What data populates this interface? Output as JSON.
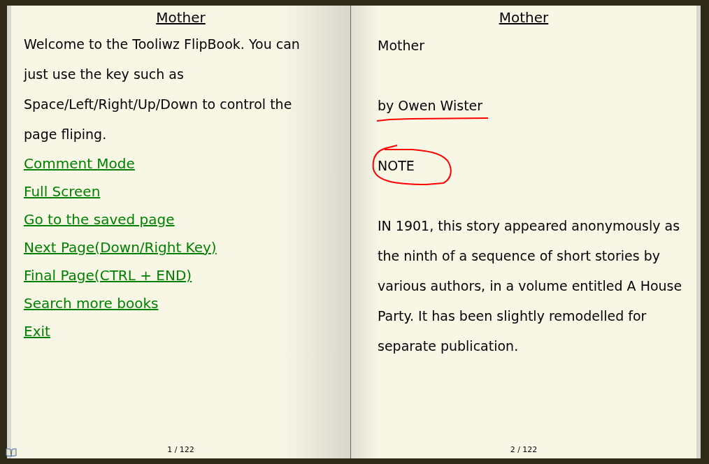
{
  "left_page": {
    "header": "Mother",
    "intro": "Welcome to the Tooliwz FlipBook. You can just use the key such as Space/Left/Right/Up/Down to control the page fliping.",
    "links": [
      "Comment Mode",
      "Full Screen",
      "Go to the saved page",
      "Next Page(Down/Right Key)",
      "Final Page(CTRL + END)",
      "Search more books",
      "Exit"
    ],
    "page_number": "1 / 122"
  },
  "right_page": {
    "header": "Mother",
    "blocks": [
      {
        "text": "Mother"
      },
      {
        "text": "by Owen Wister",
        "underlined": true
      },
      {
        "text": "NOTE",
        "circled": true
      },
      {
        "text": "IN 1901, this story appeared anonymously as the ninth of a sequence of short stories by various authors, in a volume entitled A House Party. It has been slightly remodelled for separate publication."
      }
    ],
    "page_number": "2 / 122"
  }
}
